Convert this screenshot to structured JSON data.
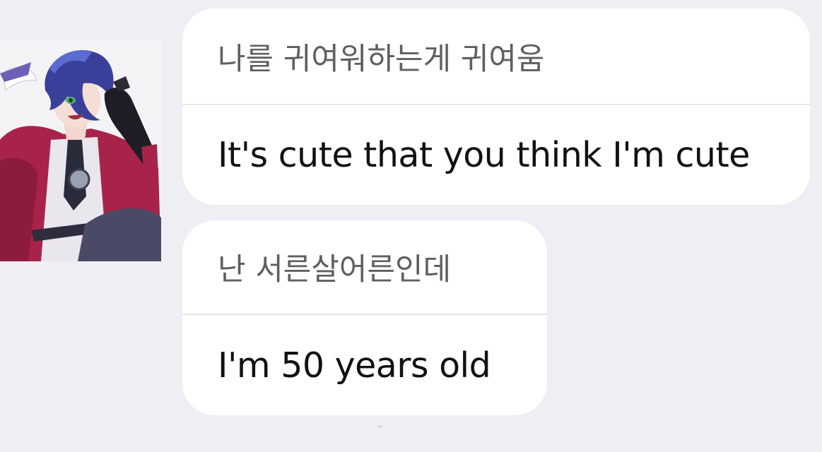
{
  "messages": [
    {
      "original": "나를 귀여워하는게 귀여움",
      "translation": "It's cute that you think I'm cute"
    },
    {
      "original": "난 서른살어른인데",
      "translation": "I'm 50 years old"
    }
  ],
  "colors": {
    "background": "#efeef3",
    "bubble": "#ffffff",
    "original_text": "#5f5f63",
    "translated_text": "#111114",
    "avatar_hair": "#3a3f9a",
    "avatar_jacket": "#a8234a"
  },
  "avatar": {
    "icon": "anime-character-avatar"
  }
}
